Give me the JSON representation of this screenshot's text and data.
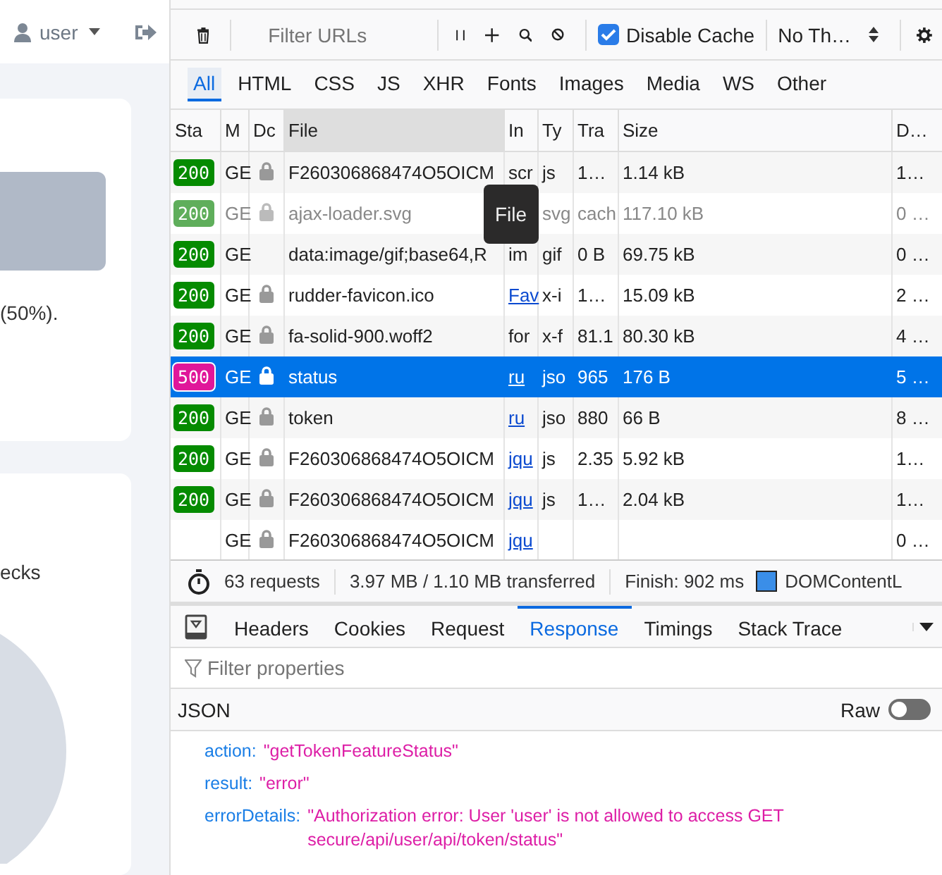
{
  "page": {
    "user_menu": {
      "label": "user"
    },
    "cards": [
      {
        "text": "(50%)."
      },
      {
        "text": "ecks"
      }
    ]
  },
  "devtools": {
    "toolbar": {
      "filter_placeholder": "Filter URLs",
      "disable_cache": {
        "label": "Disable Cache",
        "checked": true
      },
      "throttle": "No Th…"
    },
    "type_tabs": [
      {
        "label": "All",
        "selected": true
      },
      {
        "label": "HTML",
        "selected": false
      },
      {
        "label": "CSS",
        "selected": false
      },
      {
        "label": "JS",
        "selected": false
      },
      {
        "label": "XHR",
        "selected": false
      },
      {
        "label": "Fonts",
        "selected": false
      },
      {
        "label": "Images",
        "selected": false
      },
      {
        "label": "Media",
        "selected": false
      },
      {
        "label": "WS",
        "selected": false
      },
      {
        "label": "Other",
        "selected": false
      }
    ],
    "columns": [
      {
        "label": "Sta",
        "highlighted": false
      },
      {
        "label": "M",
        "highlighted": false
      },
      {
        "label": "Dc",
        "highlighted": false
      },
      {
        "label": "File",
        "highlighted": true
      },
      {
        "label": "In",
        "highlighted": false
      },
      {
        "label": "Ty",
        "highlighted": false
      },
      {
        "label": "Tra",
        "highlighted": false
      },
      {
        "label": "Size",
        "highlighted": false
      },
      {
        "label": "D…",
        "highlighted": false
      }
    ],
    "rows": [
      {
        "status": "200",
        "color": "#058b00",
        "method": "GE",
        "secure": true,
        "file": "F260306868474O5OICM",
        "initiator": "scr",
        "link": false,
        "type": "js",
        "transferred": "1…",
        "size": "1.14 kB",
        "duration": "1…",
        "selected": false,
        "dimmed": false
      },
      {
        "status": "200",
        "color": "#5fae5b",
        "method": "GE",
        "secure": true,
        "file": "ajax-loader.svg",
        "type": "svg",
        "transferred": "cach",
        "size": "117.10 kB",
        "duration": "0 …",
        "selected": false,
        "dimmed": true
      },
      {
        "status": "200",
        "color": "#058b00",
        "method": "GE",
        "secure": false,
        "file": "data:image/gif;base64,R",
        "initiator": "im",
        "link": false,
        "type": "gif",
        "transferred": "0 B",
        "size": "69.75 kB",
        "duration": "0 …",
        "selected": false,
        "dimmed": false
      },
      {
        "status": "200",
        "color": "#058b00",
        "method": "GE",
        "secure": true,
        "file": "rudder-favicon.ico",
        "initiator": "Fav",
        "link": true,
        "type": "x-i",
        "transferred": "1…",
        "size": "15.09 kB",
        "duration": "2 …",
        "selected": false,
        "dimmed": false
      },
      {
        "status": "200",
        "color": "#058b00",
        "method": "GE",
        "secure": true,
        "file": "fa-solid-900.woff2",
        "initiator": "for",
        "link": false,
        "type": "x-f",
        "transferred": "81.1",
        "size": "80.30 kB",
        "duration": "4 …",
        "selected": false,
        "dimmed": false
      },
      {
        "status": "500",
        "color": "#e0169a",
        "method": "GE",
        "secure": true,
        "file": "status",
        "initiator": "ru",
        "link": true,
        "type": "jso",
        "transferred": "965",
        "size": "176 B",
        "duration": "5 …",
        "selected": true,
        "dimmed": false
      },
      {
        "status": "200",
        "color": "#058b00",
        "method": "GE",
        "secure": true,
        "file": "token",
        "initiator": "ru",
        "link": true,
        "type": "jso",
        "transferred": "880",
        "size": "66 B",
        "duration": "8 …",
        "selected": false,
        "dimmed": false
      },
      {
        "status": "200",
        "color": "#058b00",
        "method": "GE",
        "secure": true,
        "file": "F260306868474O5OICM",
        "initiator": "jqu",
        "link": true,
        "type": "js",
        "transferred": "2.35",
        "size": "5.92 kB",
        "duration": "1…",
        "selected": false,
        "dimmed": false
      },
      {
        "status": "200",
        "color": "#058b00",
        "method": "GE",
        "secure": true,
        "file": "F260306868474O5OICM",
        "initiator": "jqu",
        "link": true,
        "type": "js",
        "transferred": "1…",
        "size": "2.04 kB",
        "duration": "1…",
        "selected": false,
        "dimmed": false
      },
      {
        "method": "GE",
        "secure": true,
        "file": "F260306868474O5OICM",
        "initiator": "jqu",
        "link": true,
        "duration": "0 …",
        "selected": false,
        "dimmed": false
      }
    ],
    "tooltip": "File",
    "summary": {
      "requests": "63 requests",
      "transferred": "3.97 MB / 1.10 MB transferred",
      "finish": "Finish: 902 ms",
      "dom_content": "DOMContentL"
    },
    "detail_tabs": [
      {
        "label": "Headers",
        "selected": false
      },
      {
        "label": "Cookies",
        "selected": false
      },
      {
        "label": "Request",
        "selected": false
      },
      {
        "label": "Response",
        "selected": true
      },
      {
        "label": "Timings",
        "selected": false
      },
      {
        "label": "Stack Trace",
        "selected": false
      }
    ],
    "filter_placeholder": "Filter properties",
    "json_label": "JSON",
    "raw": {
      "label": "Raw",
      "on": false
    },
    "properties": [
      {
        "key": "action:",
        "value": "\"getTokenFeatureStatus\""
      },
      {
        "key": "result:",
        "value": "\"error\""
      },
      {
        "key": "errorDetails:",
        "value": "\"Authorization error: User 'user' is not allowed to access GET secure/api/user/api/token/status\""
      }
    ]
  }
}
